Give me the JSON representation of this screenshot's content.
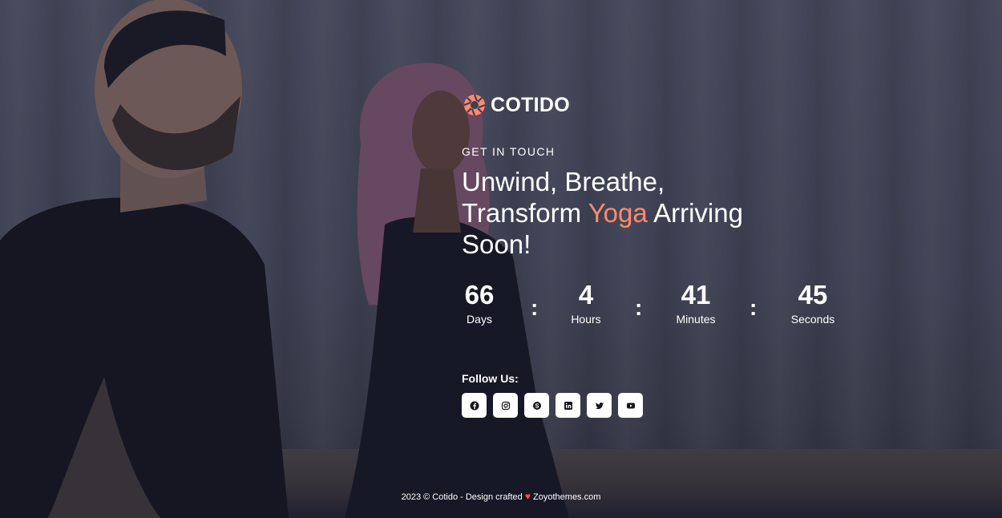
{
  "brand": {
    "name": "COTIDO",
    "logo_icon": "aperture-logo-icon",
    "accent_color": "#ff8a6e"
  },
  "hero": {
    "eyebrow": "GET IN TOUCH",
    "headline_part1": "Unwind, Breathe, Transform ",
    "headline_accent": "Yoga",
    "headline_part2": " Arriving Soon!"
  },
  "countdown": {
    "days": {
      "value": "66",
      "label": "Days"
    },
    "hours": {
      "value": "4",
      "label": "Hours"
    },
    "minutes": {
      "value": "41",
      "label": "Minutes"
    },
    "seconds": {
      "value": "45",
      "label": "Seconds"
    },
    "separator": ":"
  },
  "social": {
    "title": "Follow Us:",
    "items": [
      {
        "name": "facebook",
        "icon": "facebook-icon"
      },
      {
        "name": "instagram",
        "icon": "instagram-icon"
      },
      {
        "name": "skype",
        "icon": "skype-icon"
      },
      {
        "name": "linkedin",
        "icon": "linkedin-icon"
      },
      {
        "name": "twitter",
        "icon": "twitter-icon"
      },
      {
        "name": "youtube",
        "icon": "youtube-icon"
      }
    ]
  },
  "footer": {
    "prefix": "2023 © Cotido - Design crafted",
    "heart": "♥",
    "suffix": "Zoyothemes.com",
    "heart_color": "#ff4d4d"
  }
}
